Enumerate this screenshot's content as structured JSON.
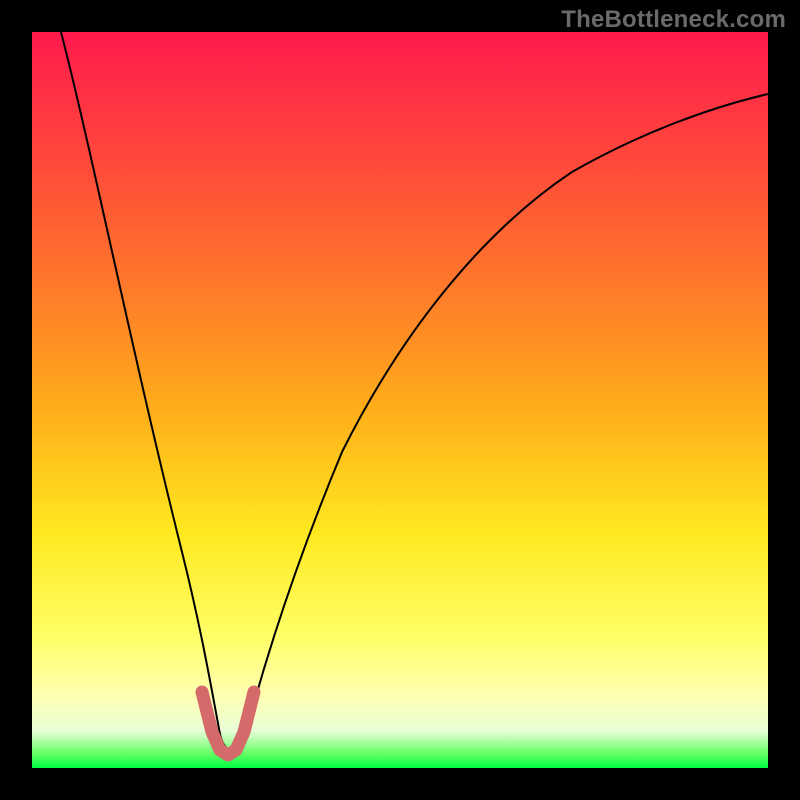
{
  "watermark": "TheBottleneck.com",
  "chart_data": {
    "type": "line",
    "title": "",
    "xlabel": "",
    "ylabel": "",
    "xlim": [
      0,
      100
    ],
    "ylim": [
      0,
      100
    ],
    "grid": false,
    "legend": false,
    "series": [
      {
        "name": "bottleneck-curve",
        "color": "#000000",
        "x": [
          4,
          8,
          12,
          16,
          20,
          22,
          24,
          25,
          26,
          27,
          28,
          30,
          34,
          40,
          48,
          58,
          70,
          84,
          100
        ],
        "y": [
          100,
          80,
          60,
          40,
          20,
          10,
          4,
          2,
          2,
          2,
          4,
          10,
          22,
          38,
          54,
          67,
          77,
          84,
          88
        ]
      },
      {
        "name": "minimum-marker",
        "color": "#d46a6a",
        "x": [
          22.5,
          23.5,
          24.5,
          25.5,
          26.5,
          27.5,
          28.5
        ],
        "y": [
          11,
          5,
          2,
          1.5,
          2,
          5,
          11
        ]
      }
    ],
    "minimum": {
      "x": 25.7,
      "y": 1.5
    }
  }
}
